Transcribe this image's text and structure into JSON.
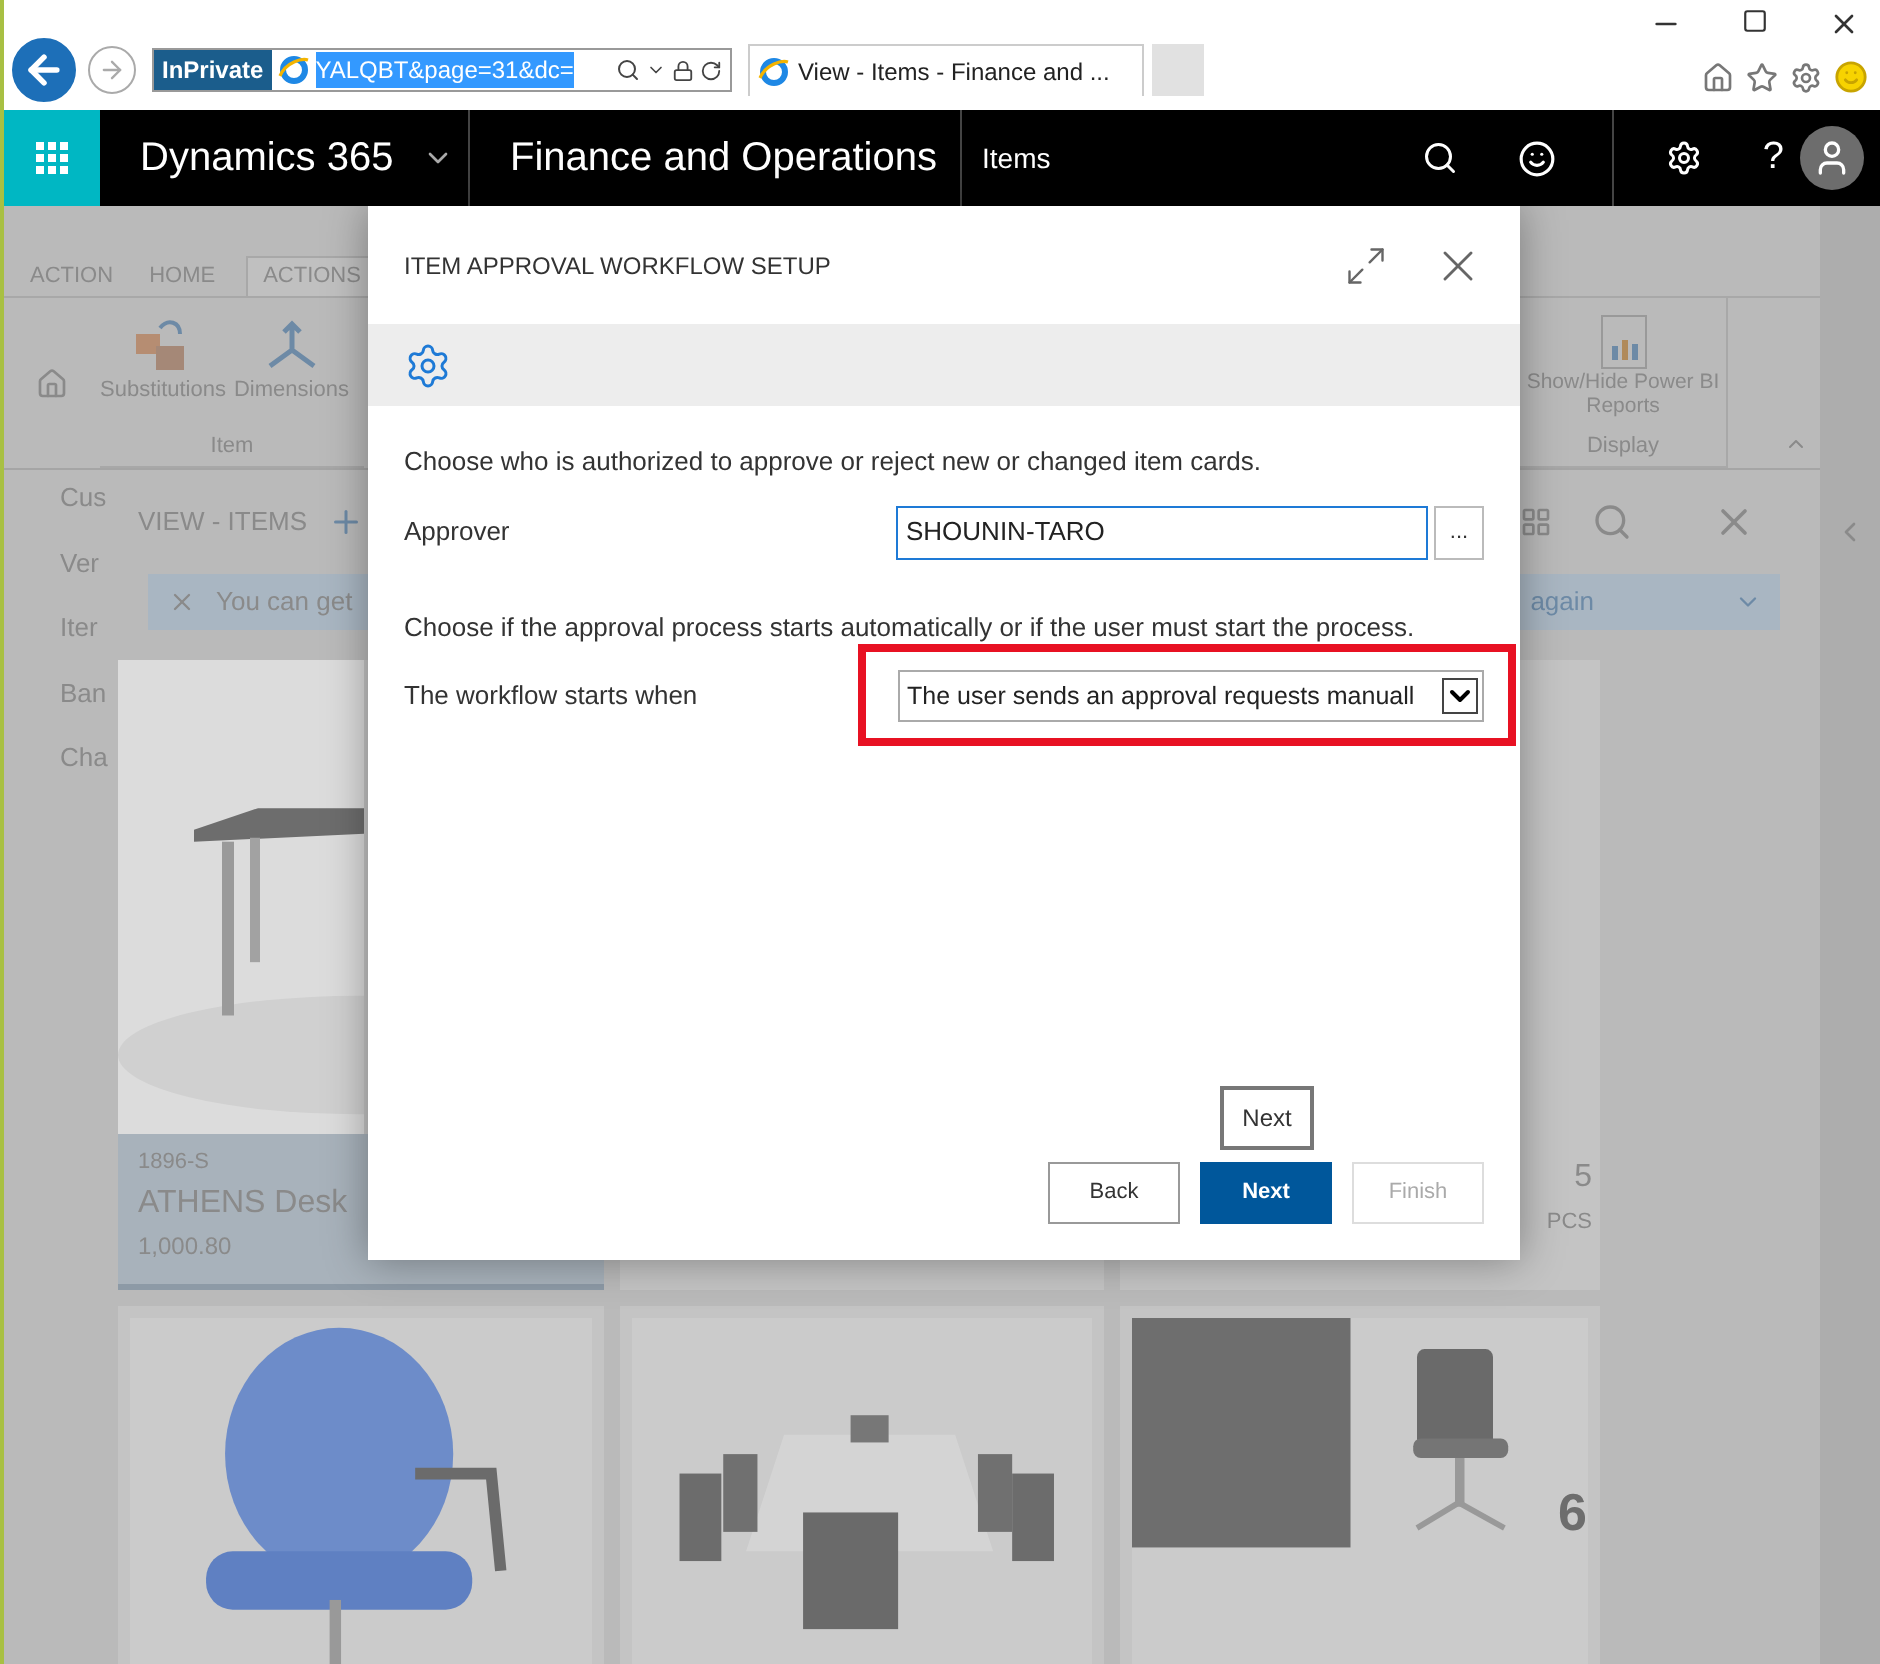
{
  "browser": {
    "badge": "InPrivate",
    "address": "YALQBT&page=31&dc=",
    "tab_title": "View - Items - Finance and ..."
  },
  "navbar": {
    "product": "Dynamics 365",
    "app": "Finance and Operations",
    "page": "Items",
    "help": "?"
  },
  "ribbon": {
    "tabs": [
      {
        "label": "ACTION",
        "selected": false
      },
      {
        "label": "HOME",
        "selected": false
      },
      {
        "label": "ACTIONS",
        "selected": true
      }
    ],
    "groups": [
      {
        "label": "Item",
        "buttons": [
          "Substitutions",
          "Dimensions"
        ]
      },
      {
        "label": "Display",
        "buttons": [
          "Show/Hide Power BI Reports"
        ]
      }
    ]
  },
  "nav_items": [
    "Cus",
    "Ver",
    "Iter",
    "Ban",
    "Cha"
  ],
  "view": {
    "title": "VIEW - ITEMS",
    "message": "You can get",
    "message_end": "again"
  },
  "cards": [
    {
      "code": "1896-S",
      "name": "ATHENS Desk",
      "price": "1,000.80",
      "selected": true
    },
    {
      "selected": false
    },
    {
      "quantity": "5",
      "unit": "PCS",
      "selected": false
    },
    {
      "selected": false
    },
    {
      "selected": false
    },
    {
      "quantity": "6",
      "selected": false
    }
  ],
  "dialog": {
    "title": "ITEM APPROVAL WORKFLOW SETUP",
    "sections": [
      {
        "text": "Choose who is authorized to approve or reject new or changed item cards.",
        "field": {
          "kind": "lookup",
          "label": "Approver",
          "value": "SHOUNIN-TARO",
          "button": "...",
          "highlighted": false
        }
      },
      {
        "text": "Choose if the approval process starts automatically or if the user must start the process.",
        "field": {
          "kind": "dropdown",
          "label": "The workflow starts when",
          "value": "The user sends an approval requests manuall",
          "highlighted": true
        }
      }
    ],
    "tooltip": "Next",
    "buttons": [
      {
        "label": "Back",
        "kind": "secondary",
        "disabled": false
      },
      {
        "label": "Next",
        "kind": "primary",
        "disabled": false
      },
      {
        "label": "Finish",
        "kind": "secondary",
        "disabled": true
      }
    ]
  }
}
